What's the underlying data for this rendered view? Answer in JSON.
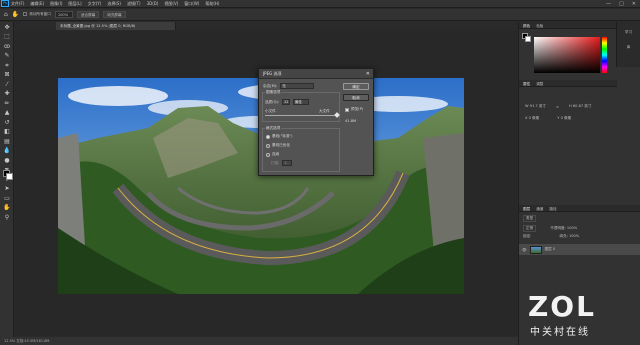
{
  "menubar": {
    "app_logo": "Ps",
    "items": [
      "文件(F)",
      "编辑(E)",
      "图像(I)",
      "图层(L)",
      "文字(Y)",
      "选择(S)",
      "滤镜(T)",
      "3D(D)",
      "视图(V)",
      "窗口(W)",
      "帮助(H)"
    ],
    "window_buttons": [
      "—",
      "□",
      "✕"
    ]
  },
  "options": {
    "auto_scroll_label": "滚动所有窗口",
    "zoom_value": "100%",
    "fit_screen_label": "适合屏幕",
    "fill_screen_label": "填充屏幕"
  },
  "document": {
    "tab_title": "未标题_全景图.jpg @ 12.5% (图层 0, RGB/8)",
    "status_text": "12.5%     文档:45.5M/181.8M"
  },
  "dialog": {
    "title": "JPEG 选项",
    "matte_label": "杂边(M):",
    "matte_value": "无",
    "image_options_label": "图像选项",
    "quality_label": "品质(Q):",
    "quality_value": "12",
    "quality_level": "最佳",
    "small_file_label": "小文件",
    "large_file_label": "大文件",
    "format_options_label": "格式选项",
    "format_options": [
      "基线(\"标准\")",
      "基线已优化",
      "连续"
    ],
    "scans_label": "扫描:",
    "scans_value": "3",
    "ok_label": "确定",
    "cancel_label": "取消",
    "preview_label": "预览(P)",
    "size_text": "41.8M",
    "quality_fraction": 1.0
  },
  "panels": {
    "top_tabs": [
      "颜色",
      "色板"
    ],
    "side_tabs": [
      "学习",
      "库"
    ],
    "properties_tabs": [
      "属性",
      "调整"
    ],
    "properties_rows": [
      {
        "a": "W 91.7 英寸",
        "b": "H 60.87 英寸"
      },
      {
        "a": "X 0 像素",
        "b": "Y 0 像素"
      }
    ],
    "layers_tabs": [
      "图层",
      "通道",
      "路径"
    ],
    "layers_kind": "类型",
    "layers_mode": "正常",
    "layers_opacity": "不透明度: 100%",
    "layers_lock": "锁定:",
    "layers_fill": "填充: 100%",
    "layer_name": "图层 0"
  },
  "watermark": {
    "brand": "ZOL",
    "subtitle": "中关村在线"
  },
  "colors": {
    "accent": "#31a8ff",
    "fg": "#000000",
    "bg": "#ffffff"
  }
}
